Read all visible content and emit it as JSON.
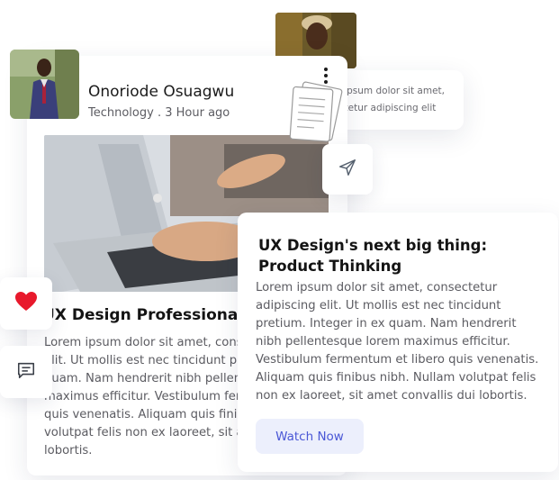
{
  "back_card": {
    "text": "Lorem ipsum dolor sit amet, consectetur adipiscing elit"
  },
  "post": {
    "author_name": "Onoriode Osuagwu",
    "category": "Technology .",
    "time_ago": "3 Hour ago",
    "title": "UX Design Professional Ce",
    "body_lines": [
      "Lorem ipsum dolor sit amet, consec",
      "elit. Ut mollis est nec tincidunt pretiu",
      "quam. Nam hendrerit nibh pellentes",
      "maximus efficitur. Vestibulum ferme",
      "quis venenatis. Aliquam quis finibus",
      "volutpat felis non ex laoreet, sit ame",
      "lobortis."
    ]
  },
  "featured": {
    "title": "UX Design's next big thing: Product Thinking",
    "body": "Lorem ipsum dolor sit amet, consectetur adipiscing elit. Ut mollis est nec tincidunt pretium. Integer in ex quam. Nam hendrerit nibh pellentesque lorem maximus efficitur. Vestibulum fermentum et libero quis venenatis. Aliquam quis finibus nibh. Nullam volutpat felis non ex laoreet, sit amet convallis dui lobortis.",
    "button_label": "Watch Now"
  },
  "icons": {
    "like": "heart-icon",
    "comment": "comment-icon",
    "share": "send-icon",
    "menu": "more-vertical-icon",
    "decoration": "documents-icon"
  },
  "colors": {
    "heart": "#e8192c",
    "button_bg": "#eceffc",
    "button_text": "#4a57d6"
  }
}
